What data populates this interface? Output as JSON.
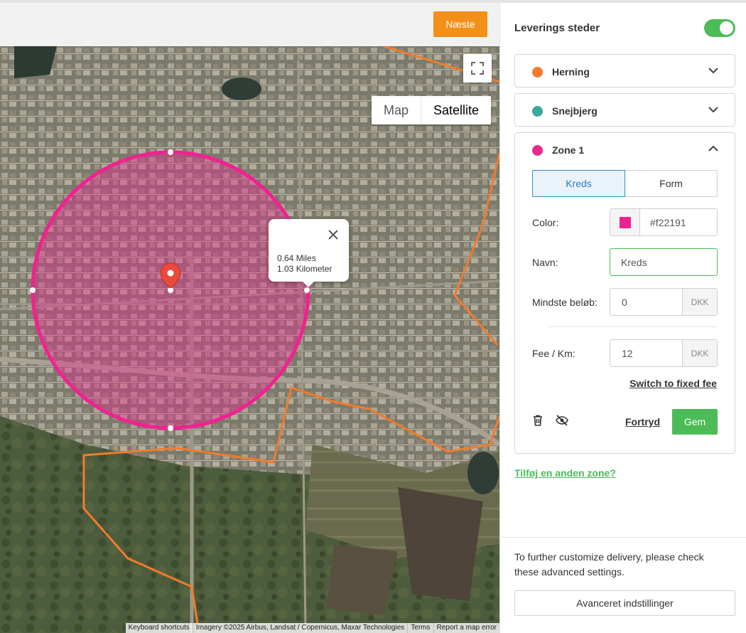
{
  "toolbar": {
    "next_label": "Næste"
  },
  "map": {
    "map_type": {
      "map_label": "Map",
      "satellite_label": "Satellite",
      "selected": "Satellite"
    },
    "popup": {
      "miles": "0.64 Miles",
      "kilometers": "1.03 Kilometer"
    },
    "attribution": [
      "Keyboard shortcuts",
      "Imagery ©2025 Airbus, Landsat / Copernicus, Maxar Technologies",
      "Terms",
      "Report a map error"
    ],
    "zone_color": "#f22191",
    "boundary_color": "#f27b2d"
  },
  "panel": {
    "title": "Leverings steder",
    "enabled": true,
    "locations": [
      {
        "name": "Herning",
        "color": "#f27b2d",
        "expanded": false
      },
      {
        "name": "Snejbjerg",
        "color": "#3aa89a",
        "expanded": false
      },
      {
        "name": "Zone 1",
        "color": "#e72a8c",
        "expanded": true
      }
    ],
    "zone": {
      "shape_tabs": [
        "Kreds",
        "Form"
      ],
      "selected_shape": "Kreds",
      "color_label": "Color:",
      "color_value": "#f22191",
      "name_label": "Navn:",
      "name_value": "Kreds",
      "min_label": "Mindste beløb:",
      "min_value": "0",
      "currency": "DKK",
      "fee_label": "Fee / Km:",
      "fee_value": "12",
      "switch_link": "Switch to fixed fee",
      "cancel_label": "Fortryd",
      "save_label": "Gem"
    },
    "add_zone": "Tilføj en anden zone?",
    "footer_text": "To further customize delivery, please check these advanced settings.",
    "advanced_label": "Avanceret indstillinger"
  }
}
